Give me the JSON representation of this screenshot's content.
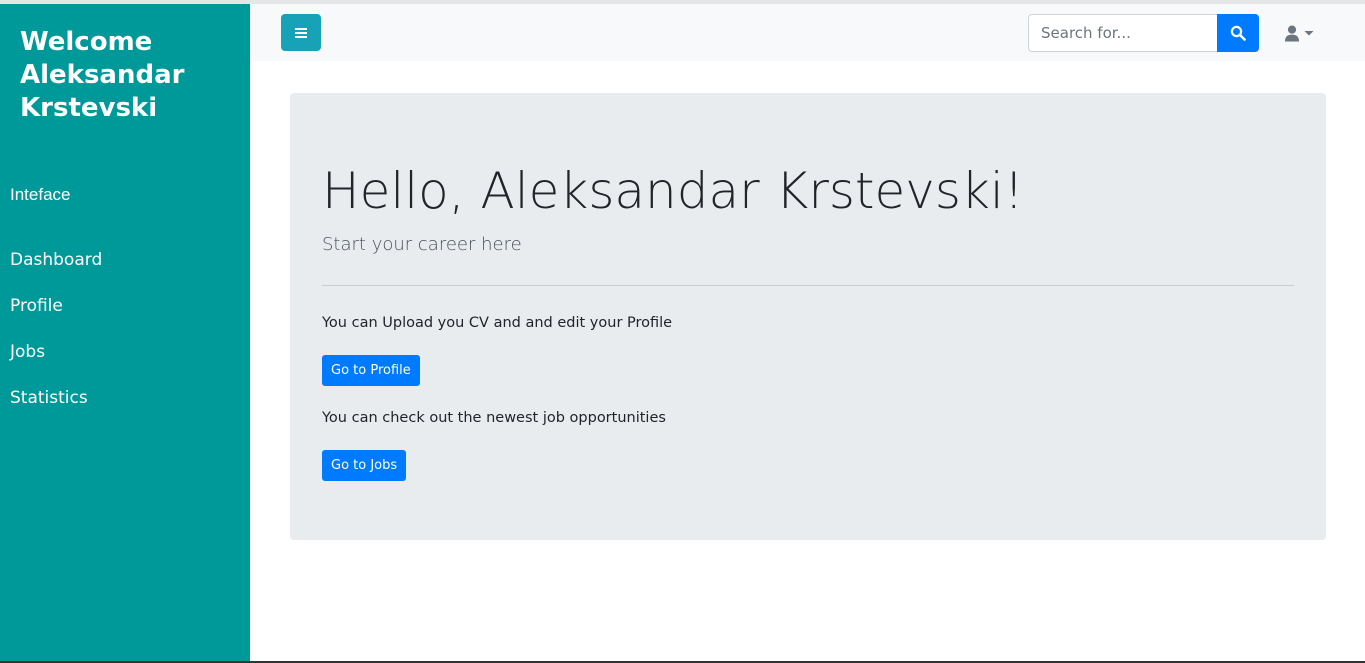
{
  "sidebar": {
    "title": "Welcome Aleksandar Krstevski",
    "section_label": "Inteface",
    "items": [
      {
        "label": "Dashboard"
      },
      {
        "label": "Profile"
      },
      {
        "label": "Jobs"
      },
      {
        "label": "Statistics"
      }
    ]
  },
  "topbar": {
    "toggle_icon": "hamburger-icon",
    "search": {
      "placeholder": "Search for...",
      "value": ""
    },
    "search_icon": "search-icon",
    "user_icon": "user-icon",
    "user_caret_icon": "caret-down-icon"
  },
  "main": {
    "heading": "Hello, Aleksandar Krstevski!",
    "lead": "Start your career here",
    "profile_text": "You can Upload you CV and and edit your Profile",
    "profile_button": "Go to Profile",
    "jobs_text": "You can check out the newest job opportunities",
    "jobs_button": "Go to Jobs"
  },
  "colors": {
    "sidebar": "#009999",
    "toggle": "#17a2b8",
    "primary": "#007bff",
    "jumbotron": "#e9ecef"
  }
}
